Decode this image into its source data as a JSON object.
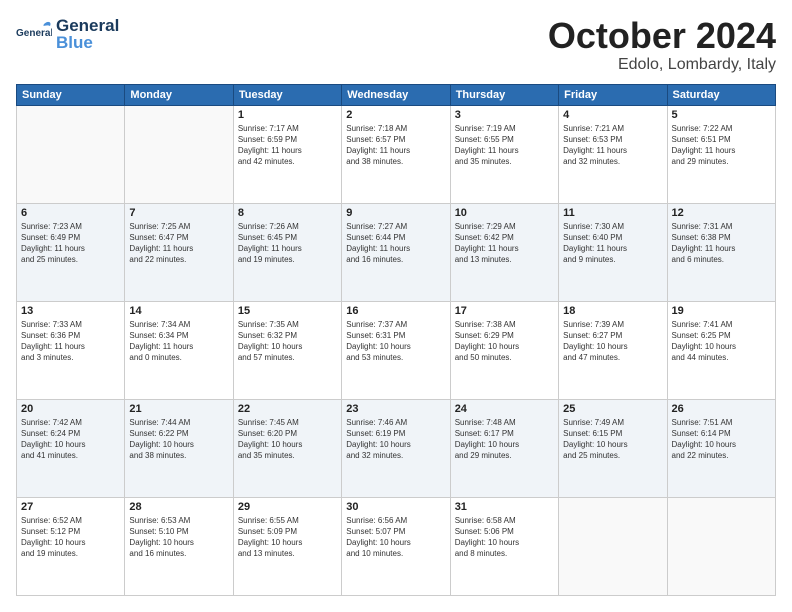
{
  "logo": {
    "line1": "General",
    "line2": "Blue"
  },
  "header": {
    "month": "October 2024",
    "location": "Edolo, Lombardy, Italy"
  },
  "weekdays": [
    "Sunday",
    "Monday",
    "Tuesday",
    "Wednesday",
    "Thursday",
    "Friday",
    "Saturday"
  ],
  "weeks": [
    [
      {
        "day": "",
        "info": ""
      },
      {
        "day": "",
        "info": ""
      },
      {
        "day": "1",
        "info": "Sunrise: 7:17 AM\nSunset: 6:59 PM\nDaylight: 11 hours\nand 42 minutes."
      },
      {
        "day": "2",
        "info": "Sunrise: 7:18 AM\nSunset: 6:57 PM\nDaylight: 11 hours\nand 38 minutes."
      },
      {
        "day": "3",
        "info": "Sunrise: 7:19 AM\nSunset: 6:55 PM\nDaylight: 11 hours\nand 35 minutes."
      },
      {
        "day": "4",
        "info": "Sunrise: 7:21 AM\nSunset: 6:53 PM\nDaylight: 11 hours\nand 32 minutes."
      },
      {
        "day": "5",
        "info": "Sunrise: 7:22 AM\nSunset: 6:51 PM\nDaylight: 11 hours\nand 29 minutes."
      }
    ],
    [
      {
        "day": "6",
        "info": "Sunrise: 7:23 AM\nSunset: 6:49 PM\nDaylight: 11 hours\nand 25 minutes."
      },
      {
        "day": "7",
        "info": "Sunrise: 7:25 AM\nSunset: 6:47 PM\nDaylight: 11 hours\nand 22 minutes."
      },
      {
        "day": "8",
        "info": "Sunrise: 7:26 AM\nSunset: 6:45 PM\nDaylight: 11 hours\nand 19 minutes."
      },
      {
        "day": "9",
        "info": "Sunrise: 7:27 AM\nSunset: 6:44 PM\nDaylight: 11 hours\nand 16 minutes."
      },
      {
        "day": "10",
        "info": "Sunrise: 7:29 AM\nSunset: 6:42 PM\nDaylight: 11 hours\nand 13 minutes."
      },
      {
        "day": "11",
        "info": "Sunrise: 7:30 AM\nSunset: 6:40 PM\nDaylight: 11 hours\nand 9 minutes."
      },
      {
        "day": "12",
        "info": "Sunrise: 7:31 AM\nSunset: 6:38 PM\nDaylight: 11 hours\nand 6 minutes."
      }
    ],
    [
      {
        "day": "13",
        "info": "Sunrise: 7:33 AM\nSunset: 6:36 PM\nDaylight: 11 hours\nand 3 minutes."
      },
      {
        "day": "14",
        "info": "Sunrise: 7:34 AM\nSunset: 6:34 PM\nDaylight: 11 hours\nand 0 minutes."
      },
      {
        "day": "15",
        "info": "Sunrise: 7:35 AM\nSunset: 6:32 PM\nDaylight: 10 hours\nand 57 minutes."
      },
      {
        "day": "16",
        "info": "Sunrise: 7:37 AM\nSunset: 6:31 PM\nDaylight: 10 hours\nand 53 minutes."
      },
      {
        "day": "17",
        "info": "Sunrise: 7:38 AM\nSunset: 6:29 PM\nDaylight: 10 hours\nand 50 minutes."
      },
      {
        "day": "18",
        "info": "Sunrise: 7:39 AM\nSunset: 6:27 PM\nDaylight: 10 hours\nand 47 minutes."
      },
      {
        "day": "19",
        "info": "Sunrise: 7:41 AM\nSunset: 6:25 PM\nDaylight: 10 hours\nand 44 minutes."
      }
    ],
    [
      {
        "day": "20",
        "info": "Sunrise: 7:42 AM\nSunset: 6:24 PM\nDaylight: 10 hours\nand 41 minutes."
      },
      {
        "day": "21",
        "info": "Sunrise: 7:44 AM\nSunset: 6:22 PM\nDaylight: 10 hours\nand 38 minutes."
      },
      {
        "day": "22",
        "info": "Sunrise: 7:45 AM\nSunset: 6:20 PM\nDaylight: 10 hours\nand 35 minutes."
      },
      {
        "day": "23",
        "info": "Sunrise: 7:46 AM\nSunset: 6:19 PM\nDaylight: 10 hours\nand 32 minutes."
      },
      {
        "day": "24",
        "info": "Sunrise: 7:48 AM\nSunset: 6:17 PM\nDaylight: 10 hours\nand 29 minutes."
      },
      {
        "day": "25",
        "info": "Sunrise: 7:49 AM\nSunset: 6:15 PM\nDaylight: 10 hours\nand 25 minutes."
      },
      {
        "day": "26",
        "info": "Sunrise: 7:51 AM\nSunset: 6:14 PM\nDaylight: 10 hours\nand 22 minutes."
      }
    ],
    [
      {
        "day": "27",
        "info": "Sunrise: 6:52 AM\nSunset: 5:12 PM\nDaylight: 10 hours\nand 19 minutes."
      },
      {
        "day": "28",
        "info": "Sunrise: 6:53 AM\nSunset: 5:10 PM\nDaylight: 10 hours\nand 16 minutes."
      },
      {
        "day": "29",
        "info": "Sunrise: 6:55 AM\nSunset: 5:09 PM\nDaylight: 10 hours\nand 13 minutes."
      },
      {
        "day": "30",
        "info": "Sunrise: 6:56 AM\nSunset: 5:07 PM\nDaylight: 10 hours\nand 10 minutes."
      },
      {
        "day": "31",
        "info": "Sunrise: 6:58 AM\nSunset: 5:06 PM\nDaylight: 10 hours\nand 8 minutes."
      },
      {
        "day": "",
        "info": ""
      },
      {
        "day": "",
        "info": ""
      }
    ]
  ]
}
